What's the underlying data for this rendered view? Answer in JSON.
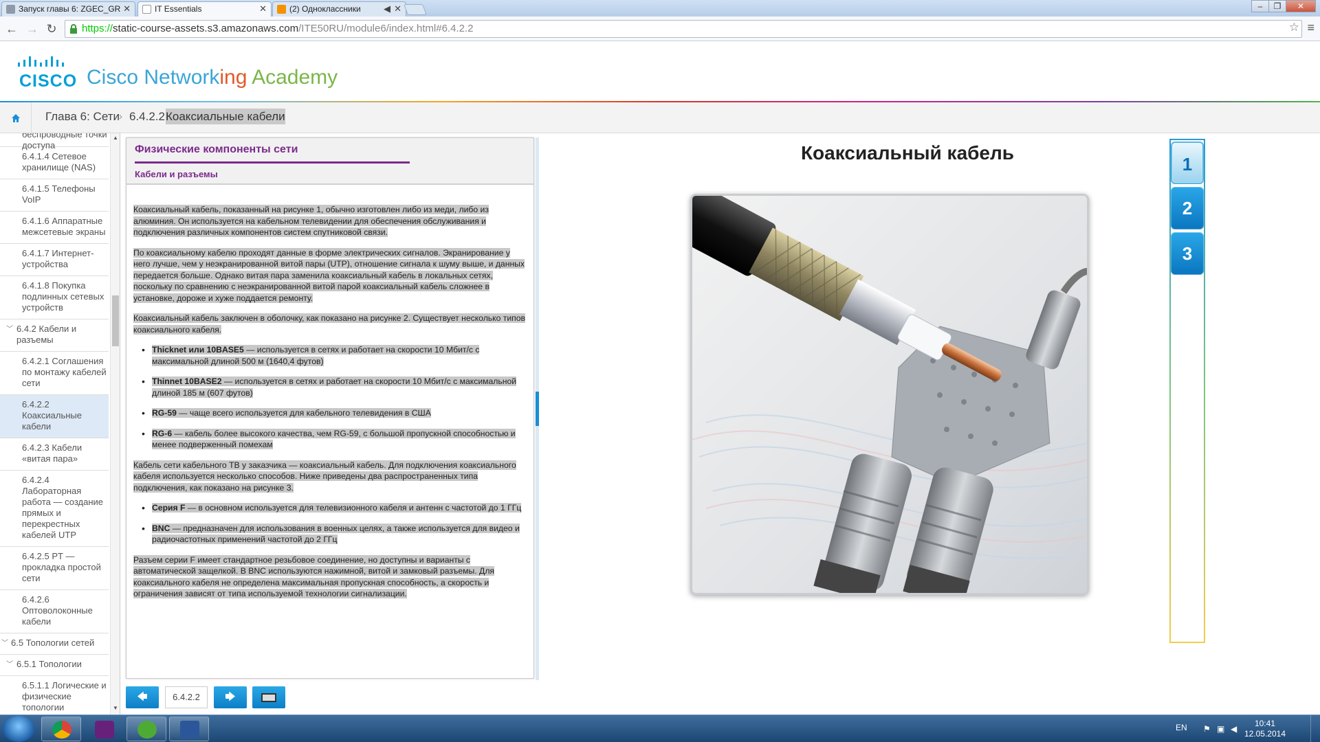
{
  "browser": {
    "tabs": [
      {
        "label": "Запуск главы 6: ZGEC_GR",
        "active": false
      },
      {
        "label": "IT Essentials",
        "active": true
      },
      {
        "label": "(2) Одноклассники",
        "active": false
      }
    ],
    "url_scheme": "https://",
    "url_host": "static-course-assets.s3.amazonaws.com",
    "url_path": "/ITE50RU/module6/index.html#6.4.2.2"
  },
  "header": {
    "cisco_word": "CISCO",
    "title_part1": "Cisco Network",
    "title_part2": "ing",
    "title_part3": " Academy"
  },
  "breadcrumb": {
    "chapter": "Глава 6: Сети",
    "number": "6.4.2.2",
    "current": "Коаксиальные кабели"
  },
  "toc": [
    {
      "label": "беспроводные точки доступа",
      "level": "topic"
    },
    {
      "label": "6.4.1.4 Сетевое хранилище (NAS)",
      "level": "topic"
    },
    {
      "label": "6.4.1.5 Телефоны VoIP",
      "level": "topic"
    },
    {
      "label": "6.4.1.6 Аппаратные межсетевые экраны",
      "level": "topic"
    },
    {
      "label": "6.4.1.7 Интернет-устройства",
      "level": "topic"
    },
    {
      "label": "6.4.1.8 Покупка подлинных сетевых устройств",
      "level": "topic"
    },
    {
      "label": "6.4.2 Кабели и разъемы",
      "level": "section"
    },
    {
      "label": "6.4.2.1 Соглашения по монтажу кабелей сети",
      "level": "topic"
    },
    {
      "label": "6.4.2.2 Коаксиальные кабели",
      "level": "topic",
      "selected": true
    },
    {
      "label": "6.4.2.3 Кабели «витая пара»",
      "level": "topic"
    },
    {
      "label": "6.4.2.4 Лабораторная работа — создание прямых и перекрестных кабелей UTP",
      "level": "topic"
    },
    {
      "label": "6.4.2.5 PT — прокладка простой сети",
      "level": "topic"
    },
    {
      "label": "6.4.2.6 Оптоволоконные кабели",
      "level": "topic"
    },
    {
      "label": "6.5 Топологии сетей",
      "level": "chapter"
    },
    {
      "label": "6.5.1 Топологии",
      "level": "section"
    },
    {
      "label": "6.5.1.1 Логические и физические топологии",
      "level": "topic"
    }
  ],
  "panel": {
    "title": "Физические компоненты сети",
    "subtitle": "Кабели и разъемы",
    "p1": "Коаксиальный кабель, показанный на рисунке 1, обычно изготовлен либо из меди, либо из алюминия. Он используется на кабельном телевидении для обеспечения обслуживания и подключения различных компонентов систем спутниковой связи.",
    "p2": "По коаксиальному кабелю проходят данные в форме электрических сигналов. Экранирование у него лучше, чем у неэкранированной витой пары (UTP), отношение сигнала к шуму выше, и данных передается больше. Однако витая пара заменила коаксиальный кабель в локальных сетях, поскольку по сравнению с неэкранированной витой парой коаксиальный кабель сложнее в установке, дороже и хуже поддается ремонту.",
    "p3": "Коаксиальный кабель заключен в оболочку, как показано на рисунке 2. Существует несколько типов коаксиального кабеля.",
    "list1": [
      {
        "term": "Thicknet или 10BASE5",
        "text": " — используется в сетях и работает на скорости 10 Мбит/с с максимальной длиной 500 м (1640,4 футов)"
      },
      {
        "term": "Thinnet 10BASE2",
        "text": " — используется в сетях и работает на скорости 10 Мбит/с с максимальной длиной 185 м (607 футов)"
      },
      {
        "term": "RG-59",
        "text": " — чаще всего используется для кабельного телевидения в США"
      },
      {
        "term": "RG-6",
        "text": " — кабель более высокого качества, чем RG-59, с большой пропускной способностью и менее подверженный помехам"
      }
    ],
    "p4": "Кабель сети кабельного ТВ у заказчика — коаксиальный кабель. Для подключения коаксиального кабеля используется несколько способов. Ниже приведены два распространенных типа подключения, как показано на рисунке 3.",
    "list2": [
      {
        "term": "Серия F",
        "text": " — в основном используется для телевизионного кабеля и антенн с частотой до 1 ГГц"
      },
      {
        "term": "BNC",
        "text": " — предназначен для использования в военных целях, а также используется для видео и радиочастотных применений частотой до 2 ГГц"
      }
    ],
    "p5": "Разъем серии F имеет стандартное резьбовое соединение, но доступны и варианты с автоматической защелкой. В BNC используются нажимной, витой и замковый разъемы. Для коаксиального кабеля не определена максимальная пропускная способность, а скорость и ограничения зависят от типа используемой технологии сигнализации."
  },
  "bottom_nav": {
    "prev_icon": "arrow-left-icon",
    "page": "6.4.2.2",
    "next_icon": "arrow-right-icon",
    "media_icon": "screen-icon"
  },
  "media": {
    "title": "Коаксиальный кабель",
    "figures": [
      "1",
      "2",
      "3"
    ],
    "active_figure": "1"
  },
  "taskbar": {
    "lang": "EN",
    "time": "10:41",
    "date": "12.05.2014"
  }
}
